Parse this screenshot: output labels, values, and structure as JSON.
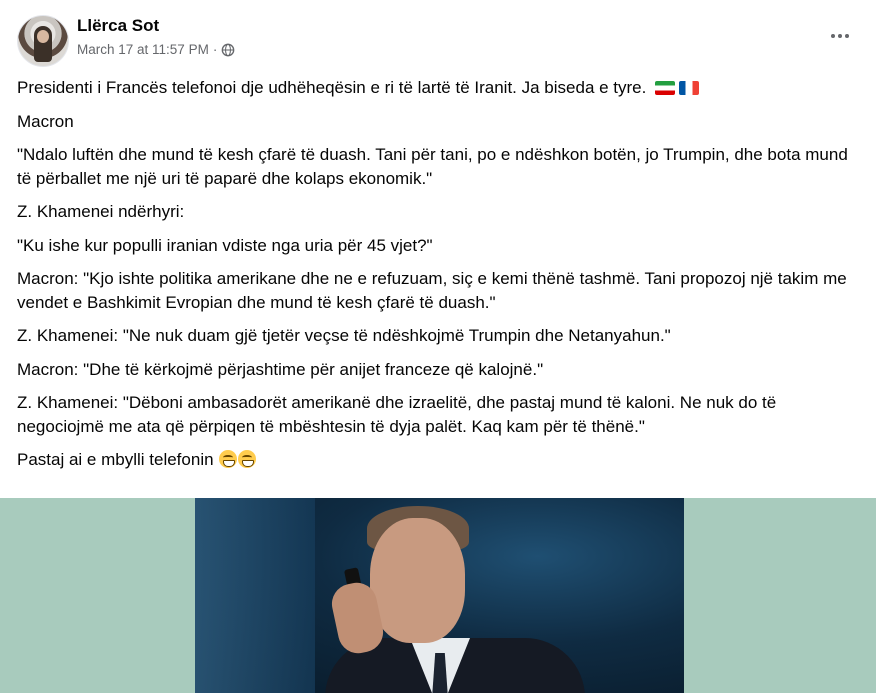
{
  "post": {
    "author": "Llërca Sot",
    "timestamp": "March 17 at 11:57 PM",
    "separator": "·",
    "privacy_icon": "globe-icon",
    "more_icon": "more-options-icon",
    "paragraphs": [
      "Presidenti i Francës telefonoi dje udhëheqësin e ri të lartë të Iranit. Ja biseda e tyre.",
      "Macron",
      "\"Ndalo luftën dhe mund të kesh çfarë të duash. Tani për tani, po e ndëshkon botën, jo Trumpin, dhe bota mund të përballet me një uri të paparë dhe kolaps ekonomik.\"",
      "Z. Khamenei ndërhyri:",
      "\"Ku ishe kur populli iranian vdiste nga uria për 45 vjet?\"",
      "Macron: \"Kjo ishte politika amerikane dhe ne e refuzuam, siç e kemi thënë tashmë. Tani propozoj një takim me vendet e Bashkimit Evropian dhe mund të kesh çfarë të duash.\"",
      "Z. Khamenei: \"Ne nuk duam gjë tjetër veçse të ndëshkojmë Trumpin dhe Netanyahun.\"",
      "Macron: \"Dhe të kërkojmë përjashtime për anijet franceze që kalojnë.\"",
      "Z. Khamenei: \"Dëboni ambasadorët amerikanë dhe izraelitë, dhe pastaj mund të kaloni. Ne nuk do të negociojmë me ata që përpiqen të mbështesin të dyja palët. Kaq kam për të thënë.\"",
      "Pastaj ai e mbylli telefonin"
    ],
    "emojis": [
      "iran-flag-icon",
      "france-flag-icon",
      "grinning-face-icon",
      "grinning-face-icon"
    ]
  },
  "colors": {
    "media_background": "#a8cbbd",
    "secondary_text": "#65676b"
  }
}
